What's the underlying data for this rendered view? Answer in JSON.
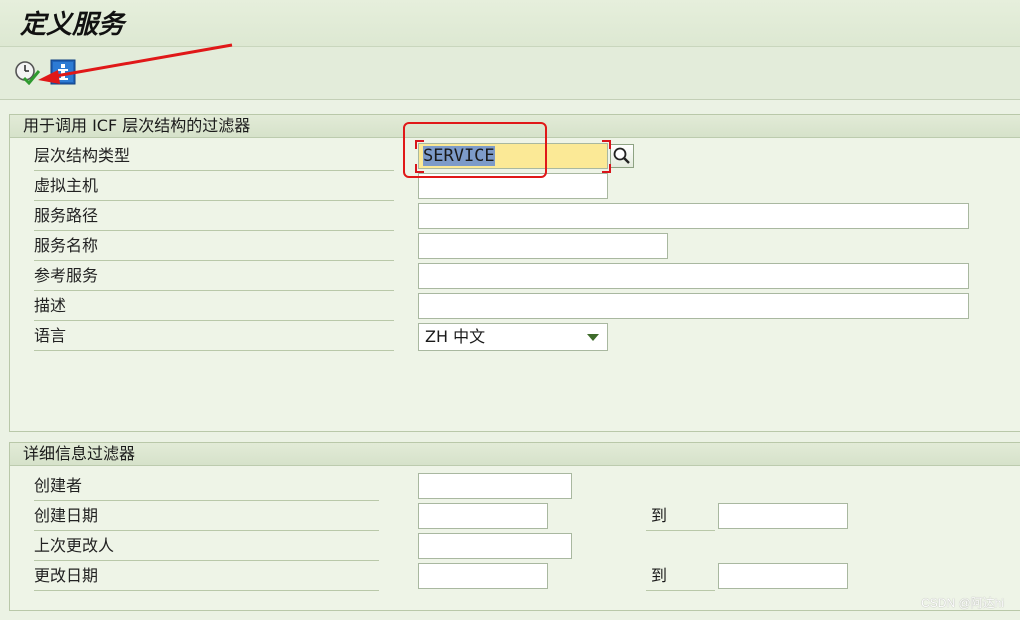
{
  "window": {
    "title": "定义服务"
  },
  "toolbar": {
    "execute_icon": "execute-clock-check-icon",
    "info_icon": "info-icon"
  },
  "filter_group": {
    "header": "用于调用 ICF 层次结构的过滤器",
    "fields": [
      {
        "label": "层次结构类型",
        "value": "SERVICE"
      },
      {
        "label": "虚拟主机",
        "value": ""
      },
      {
        "label": "服务路径",
        "value": ""
      },
      {
        "label": "服务名称",
        "value": ""
      },
      {
        "label": "参考服务",
        "value": ""
      },
      {
        "label": "描述",
        "value": ""
      },
      {
        "label": "语言",
        "value": "ZH 中文"
      }
    ]
  },
  "details_group": {
    "header": "详细信息过滤器",
    "to_label": "到",
    "fields": [
      {
        "label": "创建者",
        "value": ""
      },
      {
        "label": "创建日期",
        "from": "",
        "to": ""
      },
      {
        "label": "上次更改人",
        "value": ""
      },
      {
        "label": "更改日期",
        "from": "",
        "to": ""
      }
    ]
  },
  "colors": {
    "background": "#ebf2e4",
    "required_field": "#fbe996",
    "text_selection": "#7d9bc9",
    "annotation_red": "#e01818"
  },
  "watermark": "CSDN @阿达hi"
}
